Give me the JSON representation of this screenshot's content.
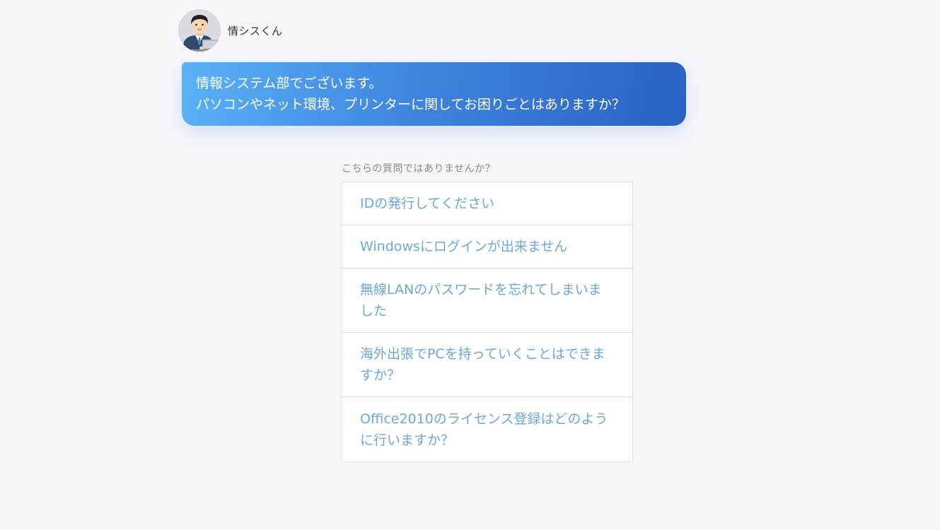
{
  "bot": {
    "name": "情シスくん",
    "avatar_icon": "office-worker-avatar-icon"
  },
  "message": {
    "lines": [
      "情報システム部でございます。",
      "パソコンやネット環境、プリンターに関してお困りごとはありますか？"
    ]
  },
  "suggestions": {
    "label": "こちらの質問ではありませんか？",
    "items": [
      "IDの発行してください",
      "Windowsにログインが出来ません",
      "無線LANのパスワードを忘れてしまいました",
      "海外出張でPCを持っていくことはできますか？",
      "Office2010のライセンス登録はどのように行いますか？"
    ]
  },
  "colors": {
    "bubble_gradient_start": "#5ab2f7",
    "bubble_gradient_end": "#2a61c4",
    "suggestion_text": "#6ba8d8",
    "background": "#f6f7fb"
  }
}
